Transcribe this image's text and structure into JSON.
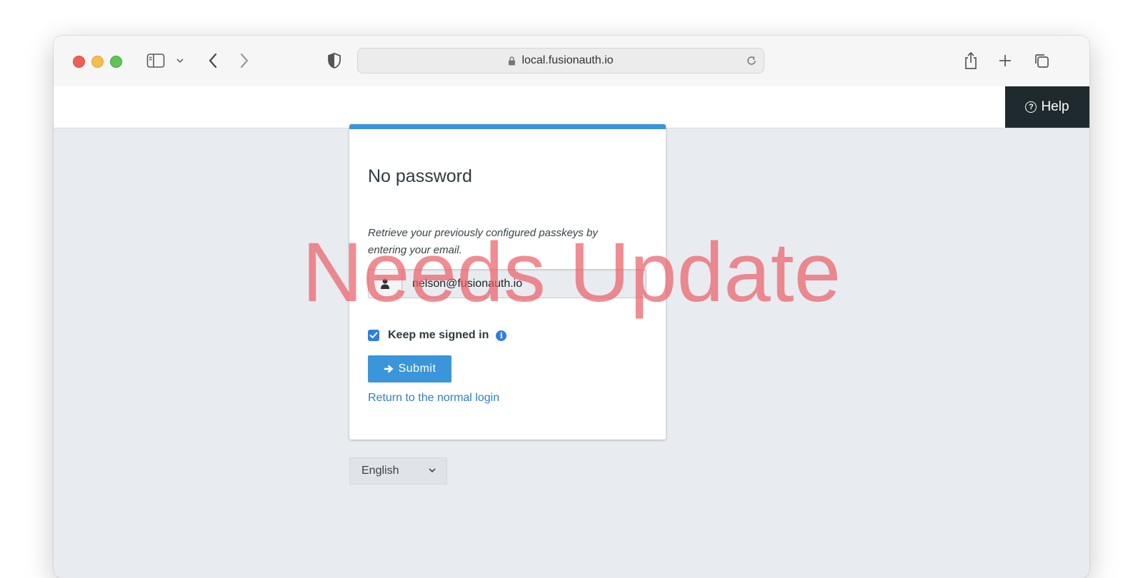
{
  "browser": {
    "url": "local.fusionauth.io"
  },
  "header": {
    "help_label": "Help"
  },
  "panel": {
    "title": "No password",
    "instructions": "Retrieve your previously configured passkeys by entering your email.",
    "email_value": "nelson@fusionauth.io",
    "keep_signed_in_label": "Keep me signed in",
    "keep_signed_in_checked": true,
    "submit_label": "Submit",
    "return_link": "Return to the normal login"
  },
  "locale": {
    "selected": "English"
  },
  "watermark": {
    "text": "Needs Update"
  },
  "colors": {
    "accent": "#3b95da",
    "help_bg": "#1f2a2e",
    "page_bg": "#e8ecf0",
    "watermark": "#ec6068"
  },
  "icons": {
    "sidebar": "sidebar-icon",
    "back": "chevron-left-icon",
    "forward": "chevron-right-icon",
    "privacy": "shield-icon",
    "lock": "lock-icon",
    "reload": "reload-icon",
    "share": "share-icon",
    "new_tab": "plus-icon",
    "tabs": "tabs-overview-icon",
    "help": "question-circle-icon",
    "user": "user-icon",
    "info": "info-icon",
    "submit": "arrow-right-icon",
    "dropdown": "chevron-down-icon"
  }
}
